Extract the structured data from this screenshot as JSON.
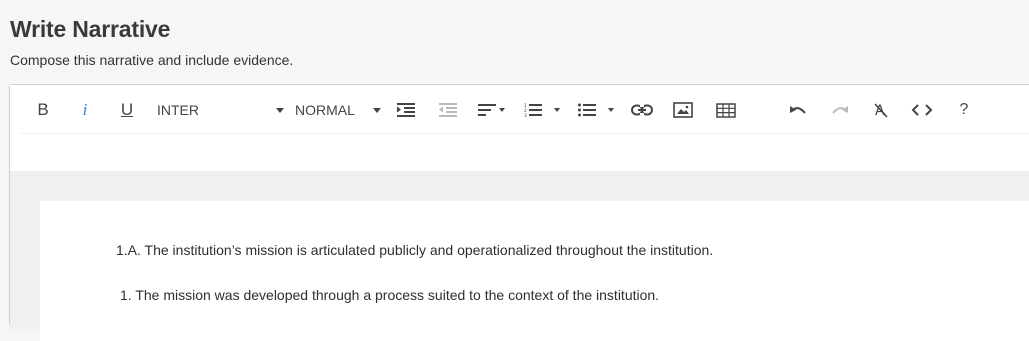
{
  "header": {
    "title": "Write Narrative",
    "subtitle": "Compose this narrative and include evidence."
  },
  "toolbar": {
    "bold_label": "B",
    "italic_label": "i",
    "underline_label": "U",
    "font_family_value": "INTER",
    "block_type_value": "NORMAL",
    "help_label": "?"
  },
  "content": {
    "paragraphs": [
      "1.A. The institution’s mission is articulated publicly and operationalized throughout the institution.",
      "1. The mission was developed through a process suited to the context of the institution."
    ]
  },
  "colors": {
    "background": "#f6f6f6",
    "editor_band": "#f0f0f0",
    "italic_accent": "#3b7ddd",
    "disabled_icon": "#bbbbbb"
  }
}
